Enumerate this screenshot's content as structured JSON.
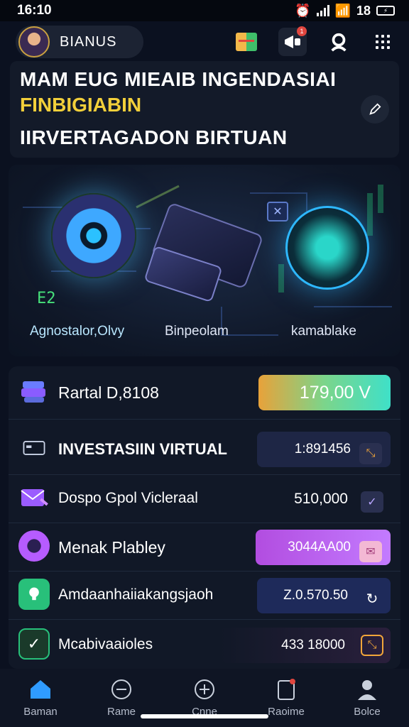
{
  "status_bar": {
    "time": "16:10",
    "battery": "18"
  },
  "header": {
    "profile_name": "BIANUS",
    "notification_badge": "1"
  },
  "hero": {
    "line1": "MAM EUG MIEAIB INGENDASIAI",
    "line2": "FINBIGIABIN",
    "line3": "IIRVERTAGADON BIRTUAN",
    "accent_color": "#f2cf3a"
  },
  "illustration": {
    "ticker": "E2",
    "labels": [
      "Agnostalor,Olvy",
      "Binpeolam",
      "kamablake"
    ]
  },
  "rows": [
    {
      "icon": "wallet-stack-icon",
      "label": "Rartal D,8108",
      "value": "179,00 V"
    },
    {
      "icon": "card-reader-icon",
      "label": "INVESTASIIN VIRTUAL",
      "value": "1:891456"
    },
    {
      "icon": "envelope-icon",
      "label": "Dospo Gpol Vicleraal",
      "value": "510,000"
    },
    {
      "icon": "target-circle-icon",
      "label": "Menak Plabley",
      "value": "3044AA00"
    },
    {
      "icon": "shield-badge-icon",
      "label": "Amdaanhaiiakangsjaoh",
      "value": "Z.0.570.50"
    },
    {
      "icon": "checkbox-icon",
      "label": "Mcabivaaioles",
      "value": "433 18000"
    }
  ],
  "nav": [
    {
      "icon": "home-icon",
      "label": "Baman"
    },
    {
      "icon": "minus-circle-icon",
      "label": "Rame"
    },
    {
      "icon": "plus-circle-icon",
      "label": "Cnne"
    },
    {
      "icon": "clipboard-icon",
      "label": "Raoime"
    },
    {
      "icon": "person-icon",
      "label": "Bolce"
    }
  ]
}
